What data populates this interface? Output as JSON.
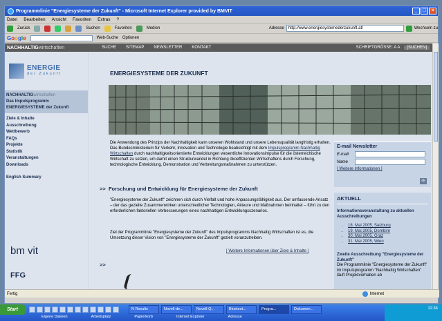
{
  "window": {
    "title": "Programmlinie \"Energiesysteme der Zukunft\" - Microsoft Internet Explorer provided by BMVIT",
    "menu": [
      "Datei",
      "Bearbeiten",
      "Ansicht",
      "Favoriten",
      "Extras",
      "?"
    ]
  },
  "toolbar": {
    "back": "Zurück",
    "search": "Suchen",
    "favorites": "Favoriten",
    "media": "Medien",
    "address_label": "Adresse",
    "address_value": "http://www.energiesystemederzukunft.at/",
    "go": "Wechseln zu",
    "links": "Links"
  },
  "googlebar": {
    "logo": [
      "G",
      "o",
      "o",
      "g",
      "l",
      "e"
    ],
    "websearch": "Web-Suche",
    "options": "Optionen"
  },
  "site": {
    "brand_bold": "NACHHALTIG",
    "brand_light": "wirtschaften",
    "nav": [
      "SUCHE",
      "SITEMAP",
      "NEWSLETTER",
      "KONTAKT"
    ],
    "font_size": "SCHRIFTGRÖSSE: A A",
    "search_btn": "[SUCHEN]"
  },
  "left": {
    "logo_title": "ENERGIE",
    "logo_sub": "der Zukunft",
    "nav_top": [
      "Das Impulsprogramm",
      "ENERGIESYSTEME der Zukunft"
    ],
    "nav": [
      "Ziele & Inhalte",
      "Ausschreibung",
      "Wettbewerb",
      "FAQs",
      "Projekte",
      "Statistik",
      "Veranstaltungen",
      "Downloads"
    ],
    "english": "English Summary",
    "bmvit": "bm vit",
    "ffg": "FFG"
  },
  "main": {
    "title": "ENERGIESYSTEME DER ZUKUNFT",
    "intro_1": "Die Anwendung des Prinzips der Nachhaltigkeit kann unseren Wohlstand und unsere Lebensqualität langfristig erhalten. Das Bundesministerium für Verkehr, Innovation und Technologie beabsichtigt mit dem ",
    "intro_link": "Impulsprogramm Nachhaltig Wirtschaften",
    "intro_2": " durch nachhaltigkeitsorientierte Entwicklungen wesentliche Innovationsimpulse für die österreichische Wirtschaft zu setzen, um damit einen Strukturwandel in Richtung ökoeffizienten Wirtschaftens durch Forschung, technologische Entwicklung, Demonstration und Verbreitungsmaßnahmen zu unterstützen.",
    "h2": "Forschung und Entwicklung für Energiesysteme der Zukunft",
    "p2": "\"Energiesysteme der Zukunft\" zeichnen sich durch Vielfalt und hohe Anpassungsfähigkeit aus. Der umfassende Ansatz – der das gezielte Zusammenwirken unterschiedlicher Technologien, Akteure und Maßnahmen beinhaltet – führt zu den erforderlichen faktoriellen Verbesserungen eines nachhaltigen Entwicklungsszenarios.",
    "p3": "Ziel der Programmlinie \"Energiesysteme der Zukunft\" des Impulsprogramms Nachhaltig Wirtschaften ist es, die Umsetzung dieser Vision von \"Energiesysteme der Zukunft\" gezielt voranzutreiben.",
    "more": "[ Weitere Informationen über Ziele & Inhalte ]"
  },
  "newsletter": {
    "title": "E-mail Newsletter",
    "email": "E-mail",
    "name": "Name",
    "more": "[ Weitere Informationen ]",
    "ok": "ok"
  },
  "aktuell": {
    "title": "AKTUELL",
    "sub": "Informationsveranstaltung zu aktuellen Ausschreibungen",
    "events": [
      "18. Mai 2005, Salzburg",
      "19. Mai 2005, Dornbirn",
      "30. Mai 2005, Graz",
      "31. Mai 2005, Wien"
    ],
    "sub2": "Zweite Ausschreibung \"Energiesysteme der Zukunft\"",
    "txt2": "Die Programmlinie \"Energiesysteme der Zukunft\" im Impulsprogramm \"Nachhaltig Wirtschaften\" läuft Projektvorhaben ab"
  },
  "status": {
    "left": "Fertig",
    "zone": "Internet"
  },
  "taskbar": {
    "start": "Start",
    "tasks": [
      "N Results",
      "Novell-de...",
      "Novell-Q...",
      "Bluetoot...",
      "Progra...",
      "Dokumen..."
    ],
    "tasks_row2": [
      "Eigene Dateien",
      "Arbeitsplatz",
      "Papierkorb",
      "Internet Explorer",
      "Adresse"
    ],
    "clock": "11:34"
  }
}
